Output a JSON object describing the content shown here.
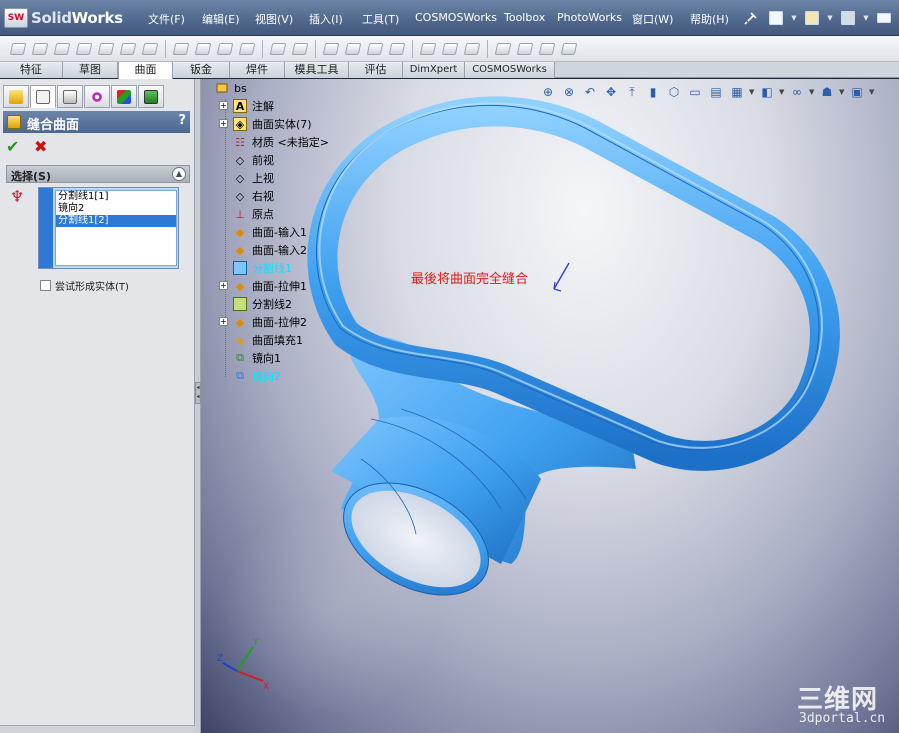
{
  "app": {
    "logo_mark": "SW",
    "logo_text_1": "Solid",
    "logo_text_2": "Works"
  },
  "menu": {
    "items": [
      "文件(F)",
      "编辑(E)",
      "视图(V)",
      "插入(I)",
      "工具(T)",
      "COSMOSWorks",
      "Toolbox",
      "PhotoWorks",
      "窗口(W)",
      "帮助(H)"
    ]
  },
  "tabs": [
    "特征",
    "草图",
    "曲面",
    "钣金",
    "焊件",
    "模具工具",
    "评估",
    "DimXpert",
    "COSMOSWorks"
  ],
  "active_tab": "曲面",
  "property_manager": {
    "title": "缝合曲面",
    "help": "?",
    "ok": "✔",
    "cancel": "✖",
    "selection_section": "选择(S)",
    "selection_items": [
      "分割线1[1]",
      "镜向2",
      "分割线1[2]"
    ],
    "selected_index": 2,
    "try_solid_label": "尝试形成实体(T)"
  },
  "tree": {
    "root": "bs",
    "nodes": [
      {
        "label": "注解",
        "expand": true
      },
      {
        "label": "曲面实体(7)",
        "expand": true
      },
      {
        "label": "材质 <未指定>",
        "expand": false
      },
      {
        "label": "前视",
        "expand": false
      },
      {
        "label": "上视",
        "expand": false
      },
      {
        "label": "右视",
        "expand": false
      },
      {
        "label": "原点",
        "expand": false
      },
      {
        "label": "曲面-输入1",
        "expand": false
      },
      {
        "label": "曲面-输入2",
        "expand": false
      },
      {
        "label": "分割线1",
        "expand": false
      },
      {
        "label": "曲面-拉伸1",
        "expand": true
      },
      {
        "label": "分割线2",
        "expand": false
      },
      {
        "label": "曲面-拉伸2",
        "expand": true
      },
      {
        "label": "曲面填充1",
        "expand": false
      },
      {
        "label": "镜向1",
        "expand": false
      },
      {
        "label": "镜向2",
        "expand": false
      }
    ],
    "highlighted": [
      "分割线1",
      "镜向2"
    ]
  },
  "viewport": {
    "callout_text": "最後将曲面完全缝合",
    "triad_labels": {
      "x": "X",
      "y": "Y",
      "z": "Z"
    },
    "watermark_cn": "三维网",
    "watermark_en": "3dportal.cn"
  },
  "colors": {
    "model_blue": "#3fa0f0",
    "callout_red": "#e21b1b",
    "highlight_cyan": "#00e6ff",
    "menubar": "#51698d"
  }
}
